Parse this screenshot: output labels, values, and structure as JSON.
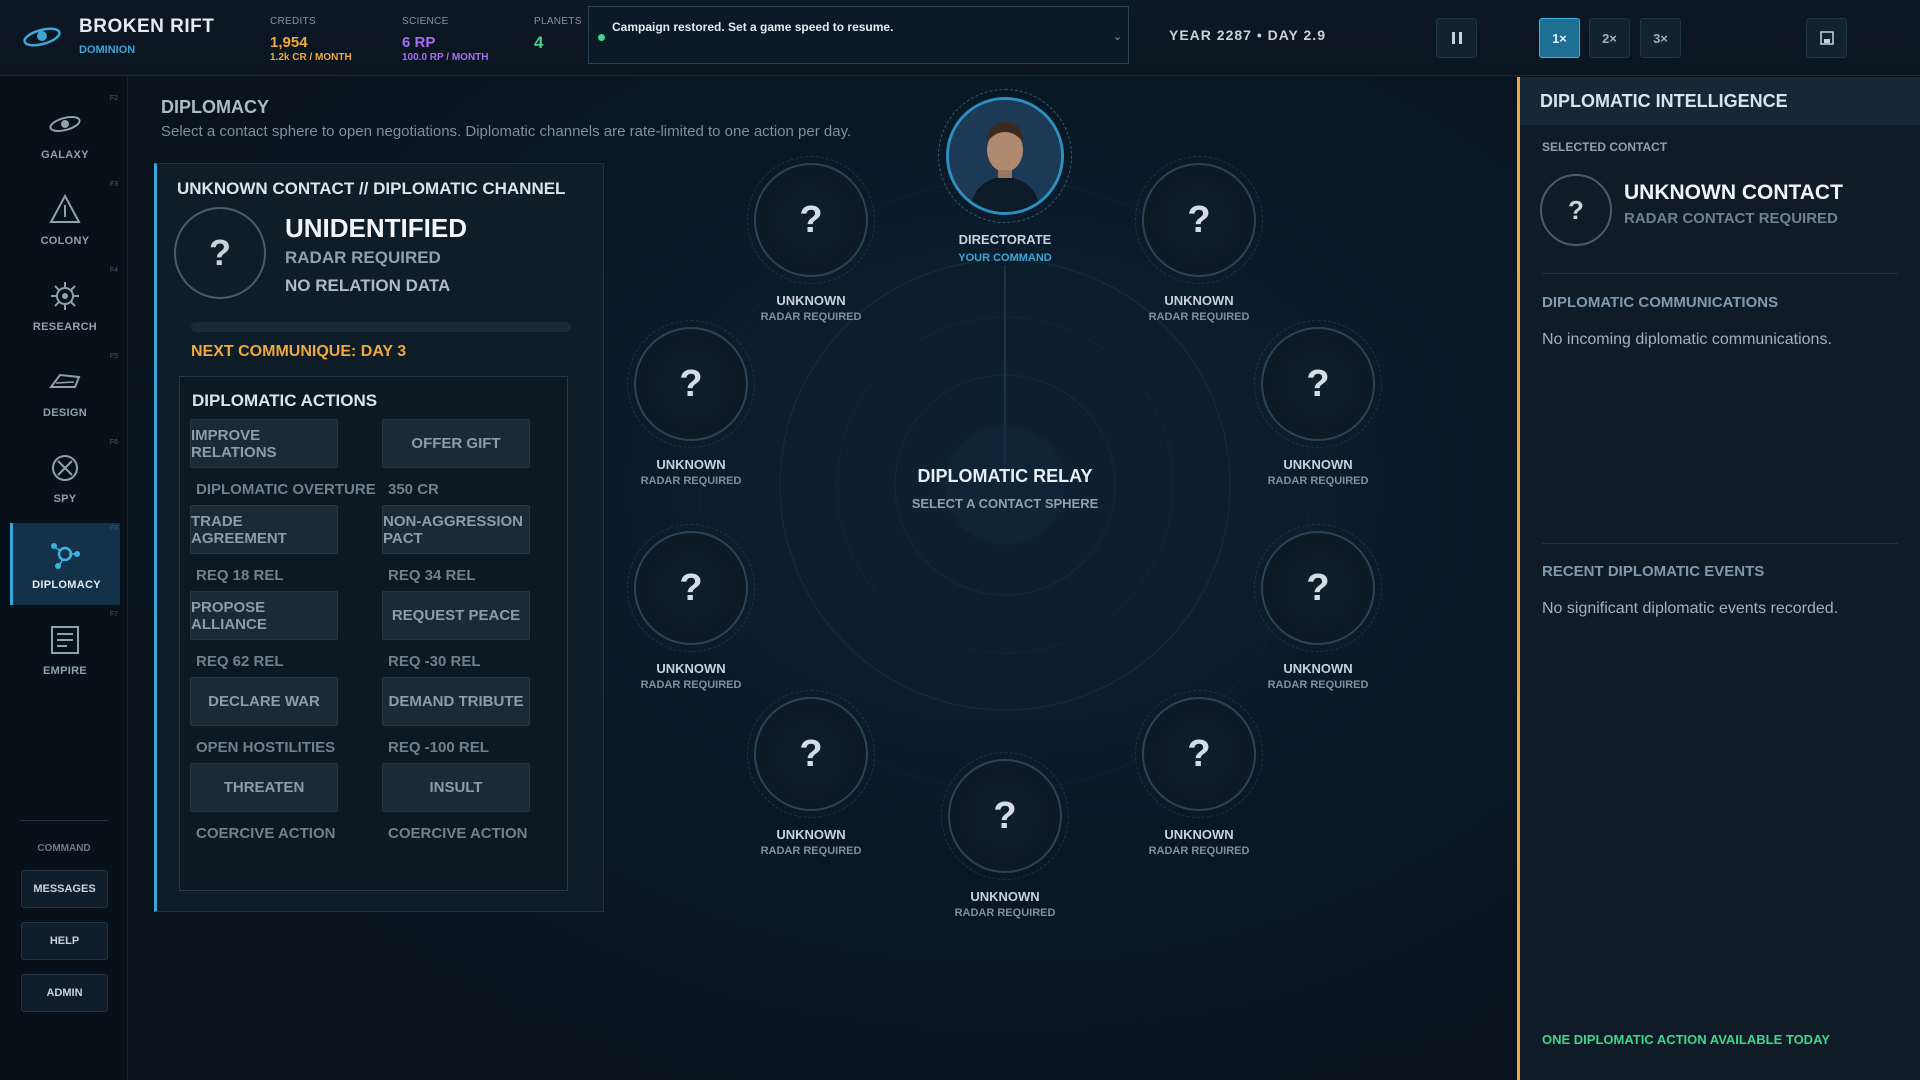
{
  "header": {
    "app_title": "BROKEN RIFT",
    "app_subtitle": "DOMINION",
    "credits": {
      "label": "CREDITS",
      "value": "1,954",
      "sub": "1.2k CR / MONTH",
      "color": "#f0a93c"
    },
    "science": {
      "label": "SCIENCE",
      "value": "6 RP",
      "sub": "100.0 RP / MONTH",
      "color": "#a56ff0"
    },
    "planets": {
      "label": "PLANETS",
      "value": "4",
      "color": "#3fd68c"
    },
    "status_message": "Campaign restored. Set a game speed to resume.",
    "date": "YEAR 2287  •  DAY 2.9",
    "pause_icon": "pause-icon",
    "speeds": [
      "1×",
      "2×",
      "3×"
    ],
    "active_speed": "1×",
    "save_icon": "save-icon"
  },
  "sidebar": {
    "items": [
      {
        "label": "GALAXY",
        "key": "F2",
        "icon": "galaxy-icon"
      },
      {
        "label": "COLONY",
        "key": "F3",
        "icon": "colony-icon"
      },
      {
        "label": "RESEARCH",
        "key": "F4",
        "icon": "research-icon"
      },
      {
        "label": "DESIGN",
        "key": "F5",
        "icon": "design-icon"
      },
      {
        "label": "SPY",
        "key": "F6",
        "icon": "spy-icon"
      },
      {
        "label": "DIPLOMACY",
        "key": "F8",
        "icon": "diplomacy-icon",
        "active": true
      },
      {
        "label": "EMPIRE",
        "key": "F7",
        "icon": "empire-icon"
      }
    ],
    "command_label": "COMMAND",
    "command_buttons": [
      "MESSAGES",
      "HELP",
      "ADMIN"
    ]
  },
  "page": {
    "title": "DIPLOMACY",
    "description": "Select a contact sphere to open negotiations. Diplomatic channels are rate-limited to one action per day."
  },
  "channel": {
    "title": "UNKNOWN CONTACT // DIPLOMATIC CHANNEL",
    "avatar_glyph": "?",
    "name": "UNIDENTIFIED",
    "line1": "RADAR REQUIRED",
    "line2": "NO RELATION DATA",
    "next_communique": "NEXT COMMUNIQUE: DAY 3",
    "actions_title": "DIPLOMATIC ACTIONS",
    "actions": [
      {
        "label": "IMPROVE RELATIONS",
        "caption": "DIPLOMATIC OVERTURE"
      },
      {
        "label": "OFFER GIFT",
        "caption": "350 CR"
      },
      {
        "label": "TRADE AGREEMENT",
        "caption": "REQ 18 REL"
      },
      {
        "label": "NON-AGGRESSION PACT",
        "caption": "REQ 34 REL"
      },
      {
        "label": "PROPOSE ALLIANCE",
        "caption": "REQ 62 REL"
      },
      {
        "label": "REQUEST PEACE",
        "caption": "REQ -30 REL"
      },
      {
        "label": "DECLARE WAR",
        "caption": "OPEN HOSTILITIES"
      },
      {
        "label": "DEMAND TRIBUTE",
        "caption": "REQ -100 REL"
      },
      {
        "label": "THREATEN",
        "caption": "COERCIVE ACTION"
      },
      {
        "label": "INSULT",
        "caption": "COERCIVE ACTION"
      }
    ]
  },
  "relay": {
    "title": "DIPLOMATIC RELAY",
    "subtitle": "SELECT A CONTACT SPHERE",
    "directorate": {
      "name": "DIRECTORATE",
      "sub": "YOUR COMMAND"
    },
    "contacts": [
      {
        "glyph": "?",
        "name": "UNKNOWN",
        "status": "RADAR REQUIRED"
      },
      {
        "glyph": "?",
        "name": "UNKNOWN",
        "status": "RADAR REQUIRED"
      },
      {
        "glyph": "?",
        "name": "UNKNOWN",
        "status": "RADAR REQUIRED"
      },
      {
        "glyph": "?",
        "name": "UNKNOWN",
        "status": "RADAR REQUIRED"
      },
      {
        "glyph": "?",
        "name": "UNKNOWN",
        "status": "RADAR REQUIRED"
      },
      {
        "glyph": "?",
        "name": "UNKNOWN",
        "status": "RADAR REQUIRED"
      },
      {
        "glyph": "?",
        "name": "UNKNOWN",
        "status": "RADAR REQUIRED"
      },
      {
        "glyph": "?",
        "name": "UNKNOWN",
        "status": "RADAR REQUIRED"
      },
      {
        "glyph": "?",
        "name": "UNKNOWN",
        "status": "RADAR REQUIRED"
      }
    ]
  },
  "intel": {
    "title": "DIPLOMATIC INTELLIGENCE",
    "selected_label": "SELECTED CONTACT",
    "selected_glyph": "?",
    "selected_name": "UNKNOWN CONTACT",
    "selected_sub": "RADAR CONTACT REQUIRED",
    "comms_title": "DIPLOMATIC COMMUNICATIONS",
    "comms_text": "No incoming diplomatic communications.",
    "events_title": "RECENT DIPLOMATIC EVENTS",
    "events_text": "No significant diplomatic events recorded.",
    "footer": "ONE DIPLOMATIC ACTION AVAILABLE TODAY"
  }
}
